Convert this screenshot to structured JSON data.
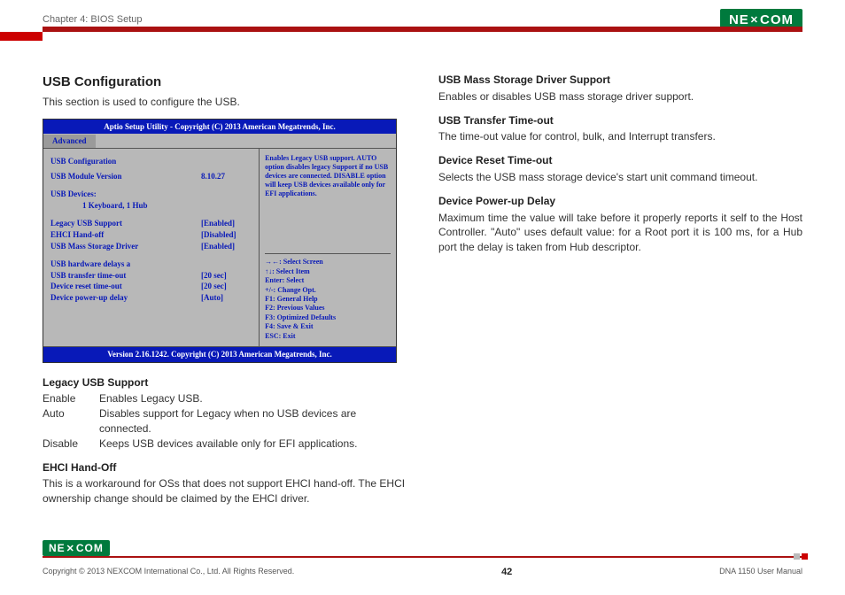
{
  "header": {
    "chapter": "Chapter 4: BIOS Setup",
    "brand": "NEXCOM"
  },
  "left": {
    "h2": "USB Configuration",
    "intro": "This section is used to configure the USB.",
    "legacy": {
      "title": "Legacy USB Support",
      "rows": [
        {
          "k": "Enable",
          "v": "Enables Legacy USB."
        },
        {
          "k": "Auto",
          "v": "Disables support for Legacy when no USB devices are connected."
        },
        {
          "k": "Disable",
          "v": "Keeps USB devices available only for EFI applications."
        }
      ]
    },
    "ehci": {
      "title": "EHCI Hand-Off",
      "body": "This is a workaround for OSs that does not support EHCI hand-off. The EHCI ownership change should be claimed by the EHCI driver."
    }
  },
  "right": {
    "mass": {
      "title": "USB Mass Storage Driver Support",
      "body": "Enables or disables USB mass storage driver support."
    },
    "transfer": {
      "title": "USB Transfer Time-out",
      "body": "The time-out value for control, bulk, and Interrupt transfers."
    },
    "reset": {
      "title": "Device Reset Time-out",
      "body": "Selects the USB mass storage device's start unit command timeout."
    },
    "power": {
      "title": "Device Power-up Delay",
      "body": "Maximum time the value will take before it properly reports it self to the Host Controller. \"Auto\" uses default value: for a Root port it is 100 ms, for a Hub port the delay is taken from Hub descriptor."
    }
  },
  "bios": {
    "title": "Aptio Setup Utility - Copyright (C) 2013 American Megatrends, Inc.",
    "tab": "Advanced",
    "section": "USB Configuration",
    "module_label": "USB Module Version",
    "module_value": "8.10.27",
    "devices_label": "USB Devices:",
    "devices_value": "1 Keyboard, 1 Hub",
    "opts": [
      {
        "lbl": "Legacy USB Support",
        "val": "[Enabled]"
      },
      {
        "lbl": "EHCI Hand-off",
        "val": "[Disabled]"
      },
      {
        "lbl": "USB Mass Storage Driver",
        "val": "[Enabled]"
      }
    ],
    "delays_hdr": "USB hardware delays a",
    "delays": [
      {
        "lbl": "USB transfer time-out",
        "val": "[20 sec]"
      },
      {
        "lbl": "Device reset time-out",
        "val": "[20 sec]"
      },
      {
        "lbl": "Device power-up delay",
        "val": "[Auto]"
      }
    ],
    "help": "Enables Legacy USB support. AUTO option disables legacy Support if no USB devices are connected. DISABLE option will keep USB devices available only for EFI applications.",
    "keys": [
      "→←: Select Screen",
      "↑↓: Select Item",
      "Enter: Select",
      "+/-: Change Opt.",
      "F1: General Help",
      "F2: Previous Values",
      "F3: Optimized Defaults",
      "F4: Save & Exit",
      "ESC: Exit"
    ],
    "footer": "Version 2.16.1242. Copyright (C) 2013 American Megatrends, Inc."
  },
  "footer": {
    "copyright": "Copyright © 2013 NEXCOM International Co., Ltd. All Rights Reserved.",
    "page": "42",
    "manual": "DNA 1150 User Manual"
  }
}
